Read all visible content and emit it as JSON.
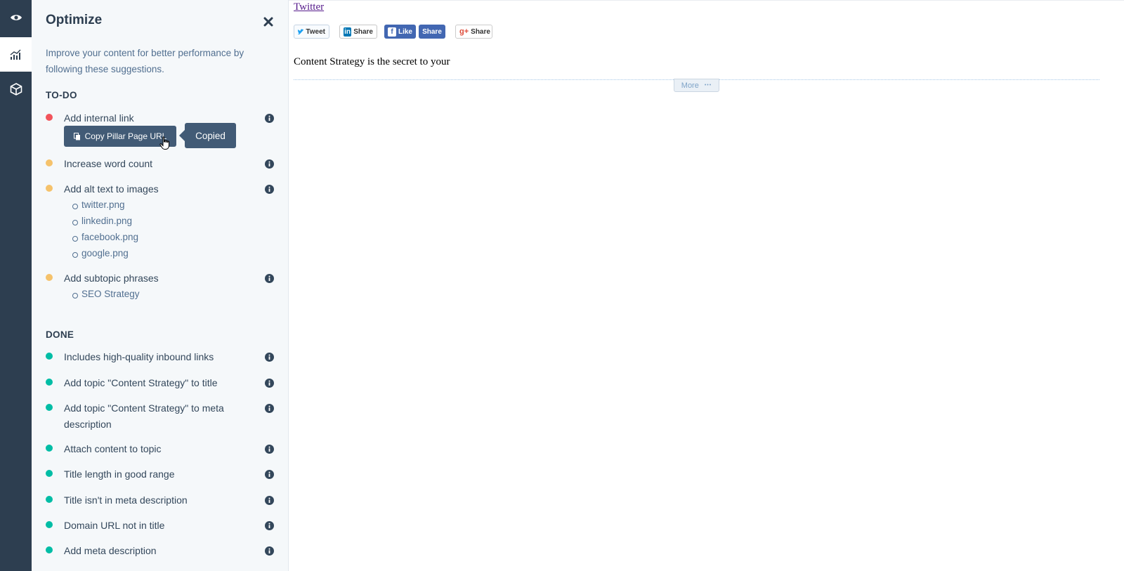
{
  "rail": {
    "items": [
      {
        "icon": "eye-icon",
        "active": false
      },
      {
        "icon": "chart-icon",
        "active": true
      },
      {
        "icon": "box-icon",
        "active": false
      }
    ]
  },
  "panel": {
    "title": "Optimize",
    "description": "Improve your content for better performance by following these suggestions.",
    "todo_heading": "TO-DO",
    "done_heading": "DONE",
    "todo": [
      {
        "label": "Add internal link",
        "status": "red",
        "subitems": []
      },
      {
        "label": "Increase word count",
        "status": "yellow",
        "subitems": []
      },
      {
        "label": "Add alt text to images",
        "status": "yellow",
        "subitems": [
          "twitter.png",
          "linkedin.png",
          "facebook.png",
          "google.png"
        ]
      },
      {
        "label": "Add subtopic phrases",
        "status": "yellow",
        "subitems": [
          "SEO Strategy"
        ]
      }
    ],
    "copy_button": "Copy Pillar Page URL",
    "tooltip": "Copied",
    "done": [
      {
        "label": "Includes high-quality inbound links"
      },
      {
        "label": "Add topic \"Content Strategy\" to title"
      },
      {
        "label": "Add topic \"Content Strategy\" to meta description"
      },
      {
        "label": "Attach content to topic"
      },
      {
        "label": "Title length in good range"
      },
      {
        "label": "Title isn't in meta description"
      },
      {
        "label": "Domain URL not in title"
      },
      {
        "label": "Add meta description"
      }
    ]
  },
  "content": {
    "twitter_link": "Twitter",
    "share_buttons": {
      "tweet": "Tweet",
      "linkedin": "Share",
      "fb_like": "Like",
      "fb_share": "Share",
      "gplus": "Share"
    },
    "body_text": "Content Strategy is the secret to your",
    "more_button": "More",
    "more_ellipsis": "•••"
  },
  "colors": {
    "rail": "#2d3e50",
    "red": "#f2545b",
    "yellow": "#f5c26b",
    "green": "#00bda5",
    "button": "#425b76"
  }
}
